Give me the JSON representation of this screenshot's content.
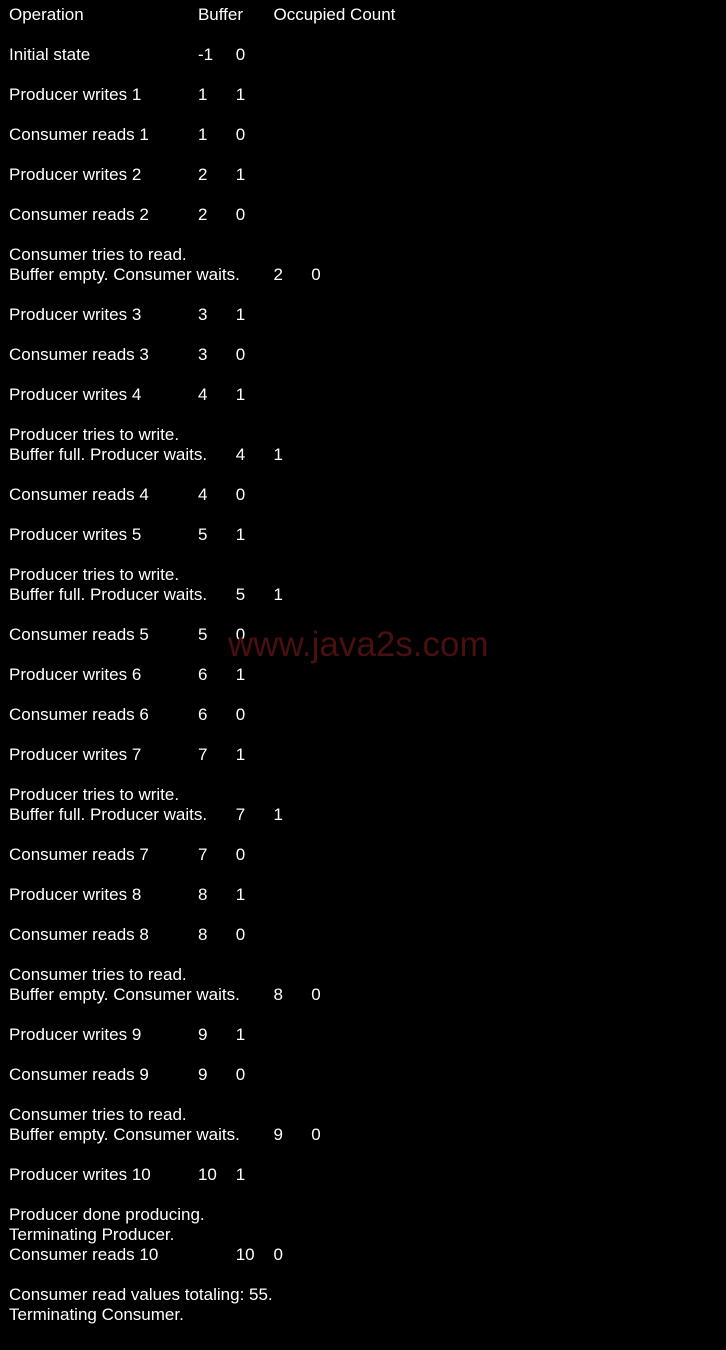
{
  "window": {
    "background_color": "#000000",
    "text_color": "#ffffff",
    "watermark_color": "#4a0f0f"
  },
  "watermark": {
    "text": "www.java2s.com"
  },
  "header": {
    "col_operation": "Operation",
    "col_buffer": "Buffer",
    "col_occupied_count": "Occupied Count",
    "line": "Operation\t\t\tBuffer\tOccupied Count"
  },
  "console": {
    "columns": [
      "Operation",
      "Buffer",
      "Occupied Count"
    ],
    "rows": [
      {
        "operation": "Initial state",
        "buffer": "-1",
        "count": "0",
        "note": "",
        "line": "Initial state\t\t\t-1\t0"
      },
      {
        "operation": "Producer writes 1",
        "buffer": "1",
        "count": "1",
        "note": "",
        "line": "Producer writes 1\t\t1\t1"
      },
      {
        "operation": "Consumer reads 1",
        "buffer": "1",
        "count": "0",
        "note": "",
        "line": "Consumer reads 1\t\t1\t0"
      },
      {
        "operation": "Producer writes 2",
        "buffer": "2",
        "count": "1",
        "note": "",
        "line": "Producer writes 2\t\t2\t1"
      },
      {
        "operation": "Consumer reads 2",
        "buffer": "2",
        "count": "0",
        "note": "",
        "line": "Consumer reads 2\t\t2\t0"
      },
      {
        "operation": "Consumer tries to read.",
        "buffer": "2",
        "count": "0",
        "note": "Buffer empty. Consumer waits.",
        "line": "Consumer tries to read.\nBuffer empty. Consumer waits.\t2\t0"
      },
      {
        "operation": "Producer writes 3",
        "buffer": "3",
        "count": "1",
        "note": "",
        "line": "Producer writes 3\t\t3\t1"
      },
      {
        "operation": "Consumer reads 3",
        "buffer": "3",
        "count": "0",
        "note": "",
        "line": "Consumer reads 3\t\t3\t0"
      },
      {
        "operation": "Producer writes 4",
        "buffer": "4",
        "count": "1",
        "note": "",
        "line": "Producer writes 4\t\t4\t1"
      },
      {
        "operation": "Producer tries to write.",
        "buffer": "4",
        "count": "1",
        "note": "Buffer full. Producer waits.",
        "line": "Producer tries to write.\nBuffer full. Producer waits.\t4\t1"
      },
      {
        "operation": "Consumer reads 4",
        "buffer": "4",
        "count": "0",
        "note": "",
        "line": "Consumer reads 4\t\t4\t0"
      },
      {
        "operation": "Producer writes 5",
        "buffer": "5",
        "count": "1",
        "note": "",
        "line": "Producer writes 5\t\t5\t1"
      },
      {
        "operation": "Producer tries to write.",
        "buffer": "5",
        "count": "1",
        "note": "Buffer full. Producer waits.",
        "line": "Producer tries to write.\nBuffer full. Producer waits.\t5\t1"
      },
      {
        "operation": "Consumer reads 5",
        "buffer": "5",
        "count": "0",
        "note": "",
        "line": "Consumer reads 5\t\t5\t0"
      },
      {
        "operation": "Producer writes 6",
        "buffer": "6",
        "count": "1",
        "note": "",
        "line": "Producer writes 6\t\t6\t1"
      },
      {
        "operation": "Consumer reads 6",
        "buffer": "6",
        "count": "0",
        "note": "",
        "line": "Consumer reads 6\t\t6\t0"
      },
      {
        "operation": "Producer writes 7",
        "buffer": "7",
        "count": "1",
        "note": "",
        "line": "Producer writes 7\t\t7\t1"
      },
      {
        "operation": "Producer tries to write.",
        "buffer": "7",
        "count": "1",
        "note": "Buffer full. Producer waits.",
        "line": "Producer tries to write.\nBuffer full. Producer waits.\t7\t1"
      },
      {
        "operation": "Consumer reads 7",
        "buffer": "7",
        "count": "0",
        "note": "",
        "line": "Consumer reads 7\t\t7\t0"
      },
      {
        "operation": "Producer writes 8",
        "buffer": "8",
        "count": "1",
        "note": "",
        "line": "Producer writes 8\t\t8\t1"
      },
      {
        "operation": "Consumer reads 8",
        "buffer": "8",
        "count": "0",
        "note": "",
        "line": "Consumer reads 8\t\t8\t0"
      },
      {
        "operation": "Consumer tries to read.",
        "buffer": "8",
        "count": "0",
        "note": "Buffer empty. Consumer waits.",
        "line": "Consumer tries to read.\nBuffer empty. Consumer waits.\t8\t0"
      },
      {
        "operation": "Producer writes 9",
        "buffer": "9",
        "count": "1",
        "note": "",
        "line": "Producer writes 9\t\t9\t1"
      },
      {
        "operation": "Consumer reads 9",
        "buffer": "9",
        "count": "0",
        "note": "",
        "line": "Consumer reads 9\t\t9\t0"
      },
      {
        "operation": "Consumer tries to read.",
        "buffer": "9",
        "count": "0",
        "note": "Buffer empty. Consumer waits.",
        "line": "Consumer tries to read.\nBuffer empty. Consumer waits.\t9\t0"
      },
      {
        "operation": "Producer writes 10",
        "buffer": "10",
        "count": "1",
        "note": "",
        "line": "Producer writes 10\t\t10\t1"
      },
      {
        "operation": "Consumer reads 10",
        "buffer": "10",
        "count": "0",
        "note": "Producer done producing.\nTerminating Producer.",
        "line": "Producer done producing.\nTerminating Producer.\nConsumer reads 10\t\t10\t0"
      }
    ],
    "footer": {
      "total_line": "Consumer read values totaling: 55.",
      "terminate_line": "Terminating Consumer.",
      "total_value": "55"
    }
  },
  "text_blocks": {
    "b00": "Operation\t\t\tBuffer\tOccupied Count",
    "b01": "Initial state\t\t\t-1\t0",
    "b02": "Producer writes 1\t\t1\t1",
    "b03": "Consumer reads 1\t\t1\t0",
    "b04": "Producer writes 2\t\t2\t1",
    "b05": "Consumer reads 2\t\t2\t0",
    "b06": "Consumer tries to read.\nBuffer empty. Consumer waits.\t2\t0",
    "b07": "Producer writes 3\t\t3\t1",
    "b08": "Consumer reads 3\t\t3\t0",
    "b09": "Producer writes 4\t\t4\t1",
    "b10": "Producer tries to write.\nBuffer full. Producer waits.\t4\t1",
    "b11": "Consumer reads 4\t\t4\t0",
    "b12": "Producer writes 5\t\t5\t1",
    "b13": "Producer tries to write.\nBuffer full. Producer waits.\t5\t1",
    "b14": "Consumer reads 5\t\t5\t0",
    "b15": "Producer writes 6\t\t6\t1",
    "b16": "Consumer reads 6\t\t6\t0",
    "b17": "Producer writes 7\t\t7\t1",
    "b18": "Producer tries to write.\nBuffer full. Producer waits.\t7\t1",
    "b19": "Consumer reads 7\t\t7\t0",
    "b20": "Producer writes 8\t\t8\t1",
    "b21": "Consumer reads 8\t\t8\t0",
    "b22": "Consumer tries to read.\nBuffer empty. Consumer waits.\t8\t0",
    "b23": "Producer writes 9\t\t9\t1",
    "b24": "Consumer reads 9\t\t9\t0",
    "b25": "Consumer tries to read.\nBuffer empty. Consumer waits.\t9\t0",
    "b26": "Producer writes 10\t\t10\t1",
    "b27": "Producer done producing.\nTerminating Producer.\nConsumer reads 10\t\t10\t0",
    "b28": "Consumer read values totaling: 55.\nTerminating Consumer."
  }
}
